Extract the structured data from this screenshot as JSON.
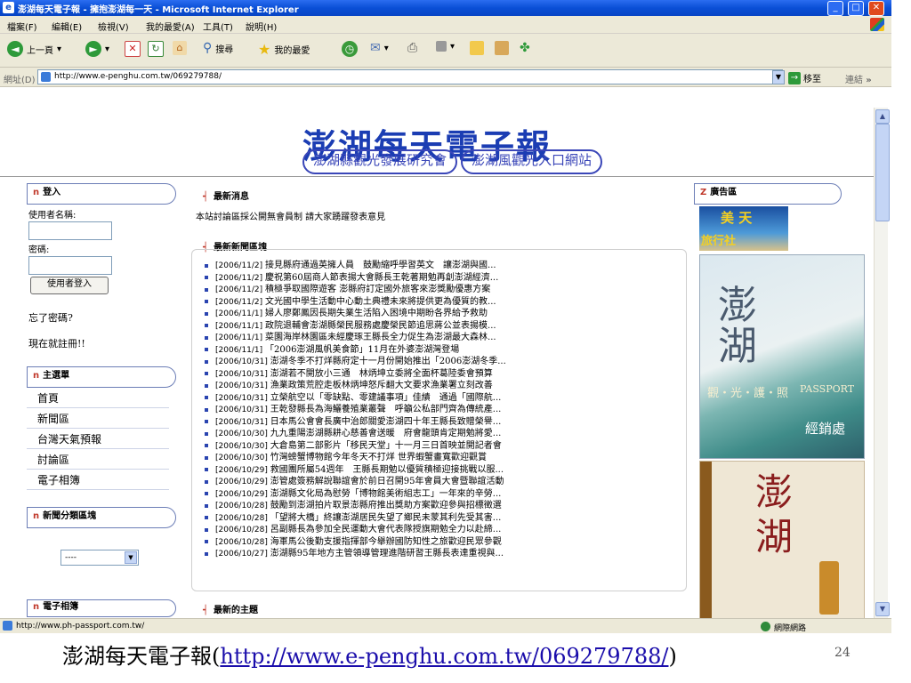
{
  "window": {
    "title": "澎湖每天電子報 - 擁抱澎湖每一天 - Microsoft Internet Explorer",
    "buttons": [
      "_",
      "□",
      "✕"
    ]
  },
  "menu": [
    "檔案(F)",
    "編輯(E)",
    "檢視(V)",
    "我的最愛(A)",
    "工具(T)",
    "說明(H)"
  ],
  "toolbar": {
    "back": "上一頁",
    "search": "搜尋",
    "favorites": "我的最愛"
  },
  "address": {
    "label": "網址(D)",
    "url": "http://www.e-penghu.com.tw/069279788/",
    "go": "移至",
    "links": "連結",
    "chevron": "»"
  },
  "page": {
    "logo": "澎湖每天電子報",
    "header_links": [
      "澎湖縣觀光發展研究會",
      "澎湖風觀光入口網站"
    ],
    "login": {
      "title": "登入",
      "username_label": "使用者名稱:",
      "password_label": "密碼:",
      "button": "使用者登入",
      "forgot": "忘了密碼?",
      "register": "現在就註冊!!"
    },
    "main_menu": {
      "title": "主選單",
      "items": [
        "首頁",
        "新聞區",
        "台灣天氣預報",
        "討論區",
        "電子相簿"
      ]
    },
    "category": {
      "title": "新聞分類區塊",
      "selected": "----"
    },
    "album": {
      "title": "電子相簿"
    },
    "section_marker": "n",
    "latest_news": {
      "title": "最新消息",
      "text": "本站討論區採公開無會員制 請大家踴躍發表意見"
    },
    "news_block": {
      "title": "最新新聞區塊",
      "items": [
        {
          "date": "[2006/11/2]",
          "text": "接見縣府通過英擁人員　鼓勵縮呼學習英文　讓澎湖與國..."
        },
        {
          "date": "[2006/11/2]",
          "text": "慶祝第60屆商人節表揚大會縣長王乾著期勉再創澎湖經濟..."
        },
        {
          "date": "[2006/11/2]",
          "text": "積極爭取國際遊客 澎縣府訂定國外旅客來澎獎勵優惠方案"
        },
        {
          "date": "[2006/11/2]",
          "text": "文光國中學生活動中心動土典禮未來將提供更為優質的教..."
        },
        {
          "date": "[2006/11/1]",
          "text": "婦人廖鄭鳳因長期失業生活陷入困境中期盼各界給予救助"
        },
        {
          "date": "[2006/11/1]",
          "text": "政院退輔會澎湖縣榮民服務處慶榮民節追思蔣公並表揚模..."
        },
        {
          "date": "[2006/11/1]",
          "text": "菜園海岸林園區未經慶琢王縣長全力促生為澎湖最大森林..."
        },
        {
          "date": "[2006/11/1]",
          "text": "「2006澎湖風帆美食節」11月在外婆澎湖灣登場"
        },
        {
          "date": "[2006/10/31]",
          "text": "澎湖冬季不打烊縣府定十一月份開始推出「2006澎湖冬季..."
        },
        {
          "date": "[2006/10/31]",
          "text": "澎湖若不開放小三通　林炳坤立委將全面杯葛陸委會預算"
        },
        {
          "date": "[2006/10/31]",
          "text": "漁業政策荒腔走板林炳坤怒斥翻大文要求漁業署立刻改善"
        },
        {
          "date": "[2006/10/31]",
          "text": "立榮航空以「零缺點、零建議事項」佳績　通過「國際航..."
        },
        {
          "date": "[2006/10/31]",
          "text": "王乾發縣長為海鱺養殖業叢聲　呼籲公私部門齊為傳統產..."
        },
        {
          "date": "[2006/10/31]",
          "text": "日本馬公會會長廣中治郎關愛澎湖四十年王縣長致贈榮譽..."
        },
        {
          "date": "[2006/10/30]",
          "text": "九九重陽澎湖縣耕心慈善會送暖　府會龍頭肯定期勉將愛..."
        },
        {
          "date": "[2006/10/30]",
          "text": "大倉島第二部影片「移民天堂」十一月三日首映並開記者會"
        },
        {
          "date": "[2006/10/30]",
          "text": "竹灣螃蟹博物館今年冬天不打烊 世界蝦蟹畫寬歡迎觀賞"
        },
        {
          "date": "[2006/10/29]",
          "text": "救國團所屬54週年　王縣長期勉以優質積極迎接挑戰以服..."
        },
        {
          "date": "[2006/10/29]",
          "text": "澎管處簽務解說聯誼會於前日召開95年會員大會暨聯誼活動"
        },
        {
          "date": "[2006/10/29]",
          "text": "澎湖縣文化局為慰勞「博物館美術組志工」一年來的辛勞..."
        },
        {
          "date": "[2006/10/28]",
          "text": "鼓勵到澎湖拍片取景澎縣府推出獎助方案歡迎參與招標徵選"
        },
        {
          "date": "[2006/10/28]",
          "text": "「望將大橋」終讓澎湖居民失望了鄉民未蒙其利先受其害..."
        },
        {
          "date": "[2006/10/28]",
          "text": "呂副縣長為參加全民運動大會代表隊授旗期勉全力以赴締..."
        },
        {
          "date": "[2006/10/28]",
          "text": "海軍馬公後勤支援指揮部今舉辦國防知性之旅歡迎民眾參觀"
        },
        {
          "date": "[2006/10/27]",
          "text": "澎湖縣95年地方主管領導管理進階研習王縣長表達重視與..."
        }
      ]
    },
    "topics": {
      "title": "最新的主題"
    },
    "ads": {
      "title": "廣告區",
      "marker": "Z",
      "banner_text": [
        "美 天",
        "旅行社"
      ],
      "passport_big": "澎湖",
      "passport_label": "觀・光・護・照",
      "passport_en": "PASSPORT",
      "passport_sub": "經銷處",
      "book_text": "澎湖"
    }
  },
  "status": {
    "url": "http://www.ph-passport.com.tw/",
    "zone": "網際網路"
  },
  "slide": {
    "caption_prefix": "澎湖每天電子報(",
    "caption_link": "http://www.e-penghu.com.tw/069279788/",
    "caption_suffix": ")",
    "page_number": "24"
  }
}
